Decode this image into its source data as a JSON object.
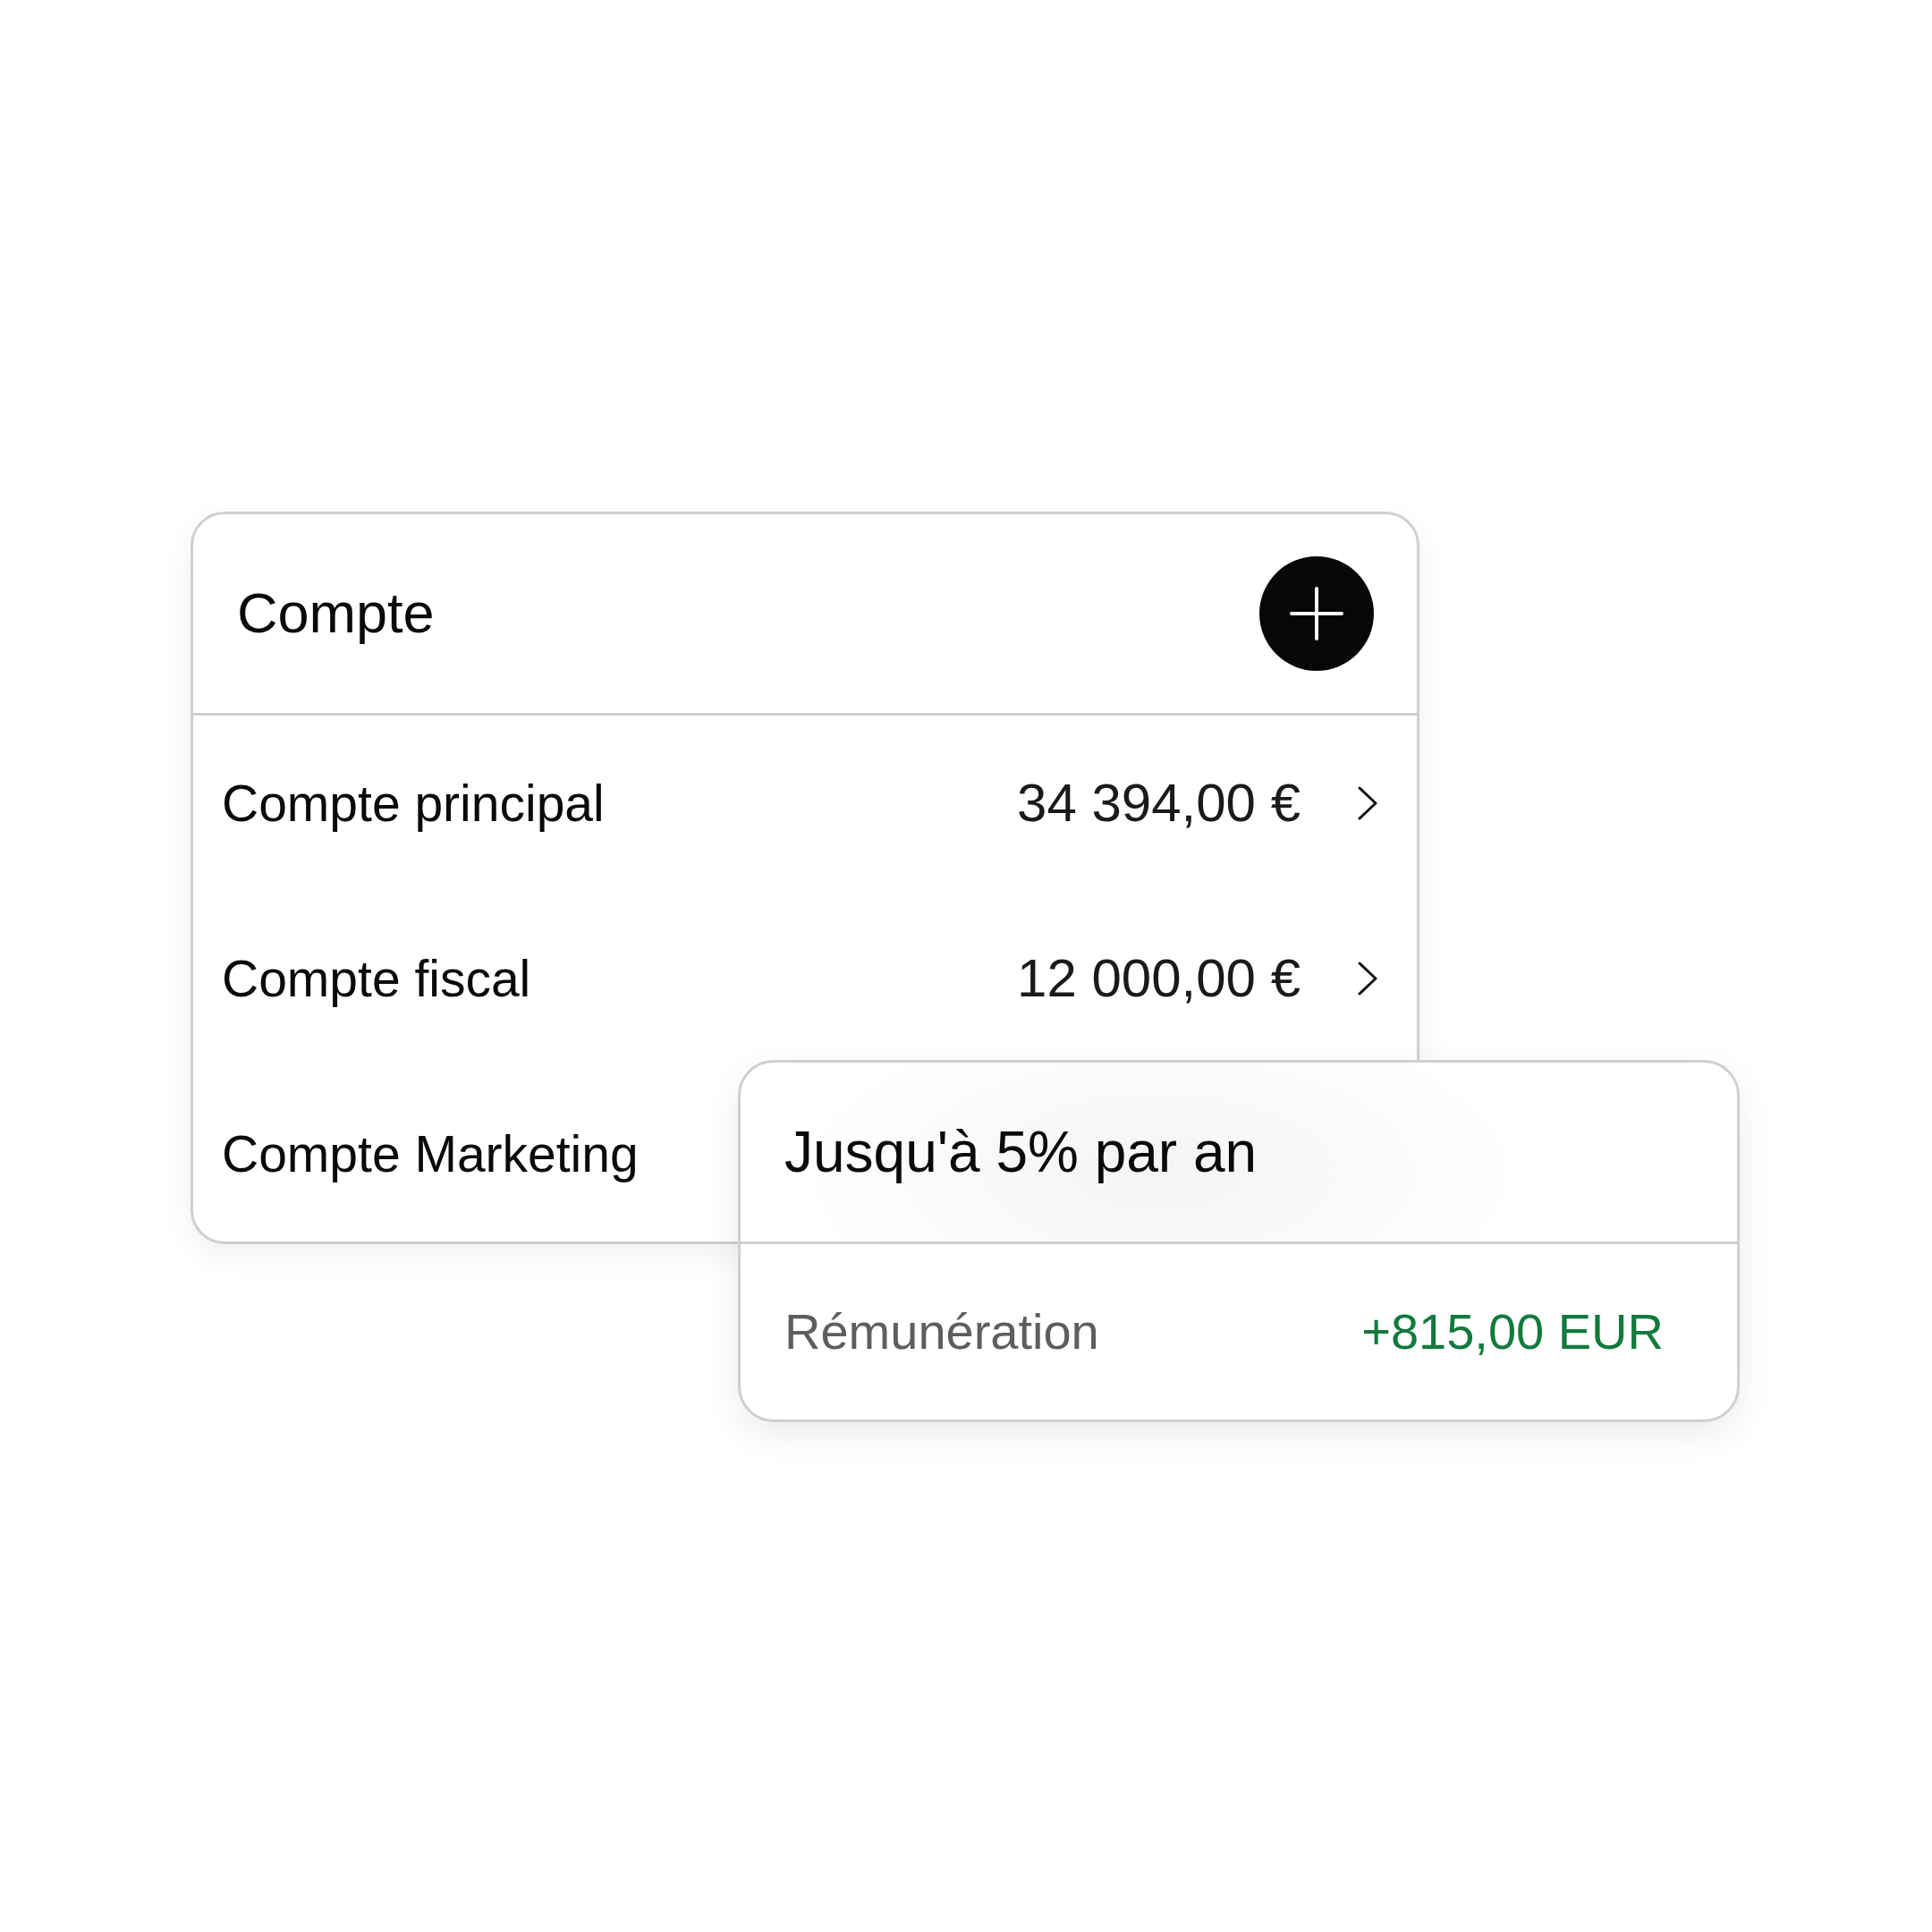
{
  "accounts_card": {
    "title": "Compte",
    "rows": [
      {
        "name": "Compte principal",
        "balance": "34 394,00 €"
      },
      {
        "name": "Compte fiscal",
        "balance": "12 000,00 €"
      },
      {
        "name": "Compte Marketing"
      }
    ]
  },
  "promo_card": {
    "title": "Jusqu'à 5% par an",
    "label": "Rémunération",
    "value": "+815,00 EUR"
  }
}
